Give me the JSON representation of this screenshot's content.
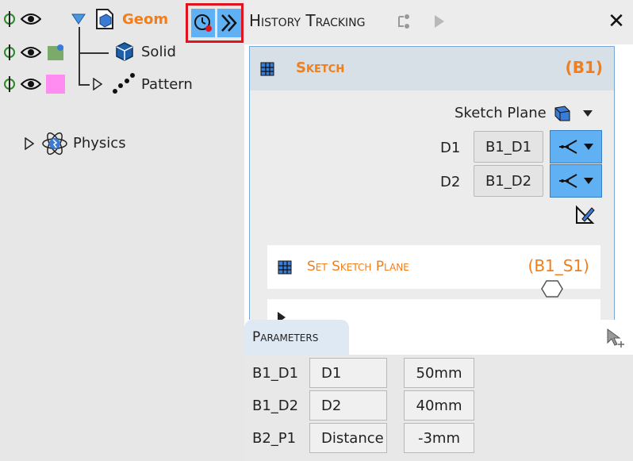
{
  "tree": {
    "geom_label": "Geom",
    "solid_label": "Solid",
    "pattern_label": "Pattern",
    "physics_label": "Physics"
  },
  "history": {
    "title": "History Tracking",
    "close_glyph": "✕"
  },
  "sketch": {
    "title": "Sketch",
    "id": "(B1)",
    "sketch_plane_label": "Sketch Plane",
    "rows": [
      {
        "label": "D1",
        "value": "B1_D1"
      },
      {
        "label": "D2",
        "value": "B1_D2"
      }
    ]
  },
  "steps": [
    {
      "title": "Set Sketch Plane",
      "id": "(B1_S1)"
    }
  ],
  "parameters": {
    "tab_label": "Parameters",
    "rows": [
      {
        "name": "B1_D1",
        "param": "D1",
        "value": "50mm"
      },
      {
        "name": "B1_D2",
        "param": "D2",
        "value": "40mm"
      },
      {
        "name": "B2_P1",
        "param": "Distance",
        "value": "-3mm"
      }
    ]
  },
  "colors": {
    "accent_orange": "#f27e1b",
    "accent_blue": "#60b0f4",
    "highlight_red": "#e0141e",
    "pattern_pink": "#ff8cf0"
  },
  "icons": {
    "visibility": "eye-icon",
    "add_node": "plus-crosshair-icon",
    "geometry": "geom-icon",
    "solid": "cube-icon",
    "pattern": "dots-icon",
    "physics": "atom-icon",
    "history": "history-clock-icon",
    "fast_forward": "double-chevron-icon",
    "play": "play-icon",
    "close": "close-icon"
  }
}
